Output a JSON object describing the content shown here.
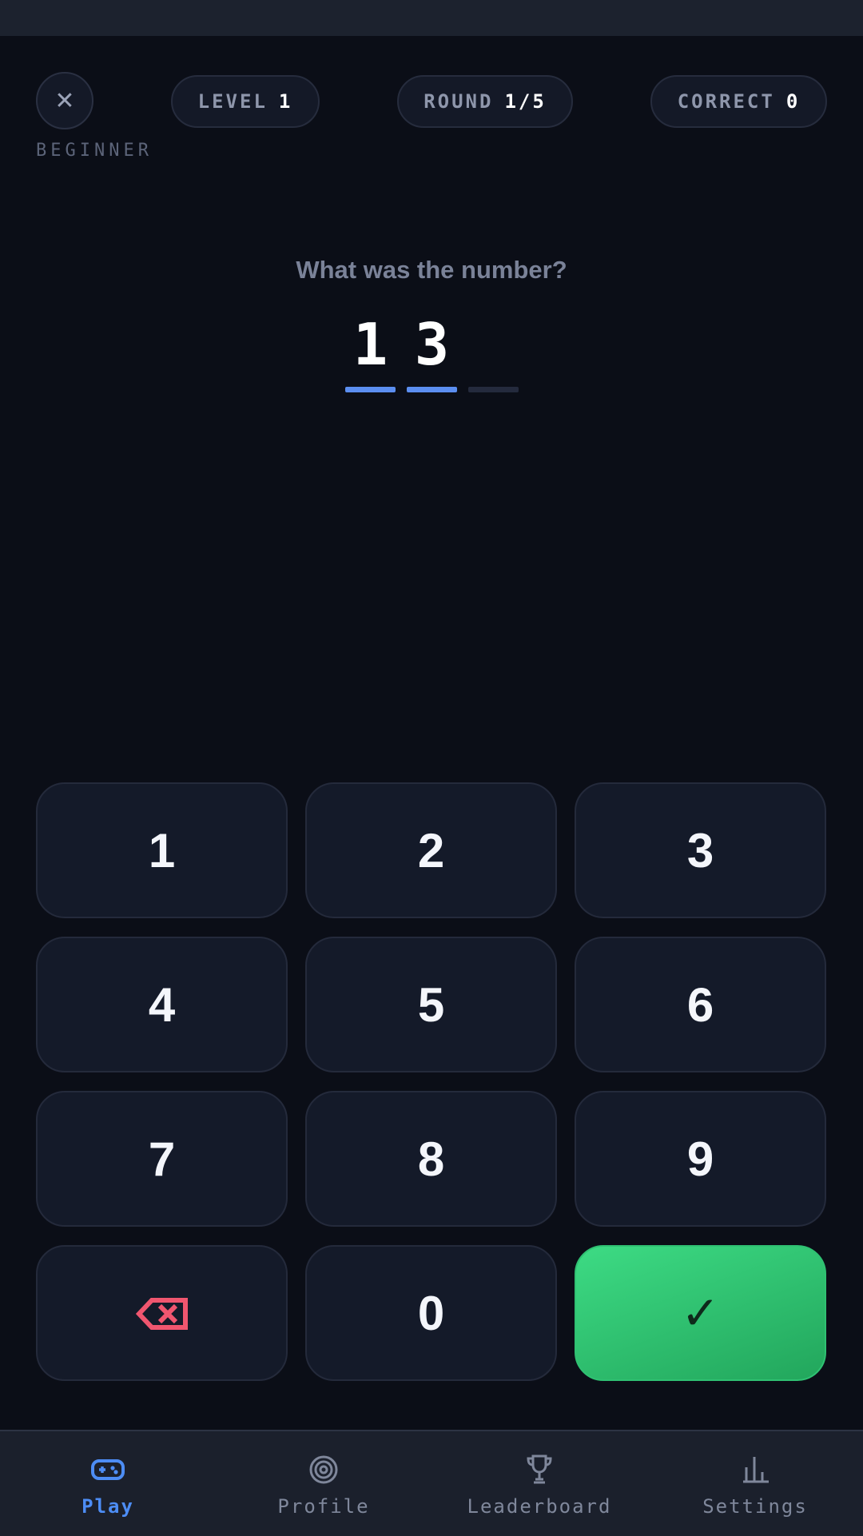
{
  "header": {
    "close_symbol": "✕",
    "difficulty": "BEGINNER",
    "level": {
      "label": "LEVEL",
      "value": "1"
    },
    "round": {
      "label": "ROUND",
      "value": "1/5"
    },
    "correct": {
      "label": "CORRECT",
      "value": "0"
    }
  },
  "question": {
    "prompt": "What was the number?",
    "entered": [
      "1",
      "3",
      ""
    ]
  },
  "keypad": {
    "keys": [
      "1",
      "2",
      "3",
      "4",
      "5",
      "6",
      "7",
      "8",
      "9"
    ],
    "backspace": "⌫",
    "zero": "0",
    "submit": "✓"
  },
  "tabs": [
    {
      "label": "Play",
      "icon": "gamepad-icon",
      "active": true
    },
    {
      "label": "Profile",
      "icon": "target-icon",
      "active": false
    },
    {
      "label": "Leaderboard",
      "icon": "trophy-icon",
      "active": false
    },
    {
      "label": "Settings",
      "icon": "bar-chart-icon",
      "active": false
    }
  ],
  "colors": {
    "background": "#0b0e17",
    "accent": "#5b8ef0",
    "submit": "#2fc172",
    "backspace": "#f0566f"
  }
}
